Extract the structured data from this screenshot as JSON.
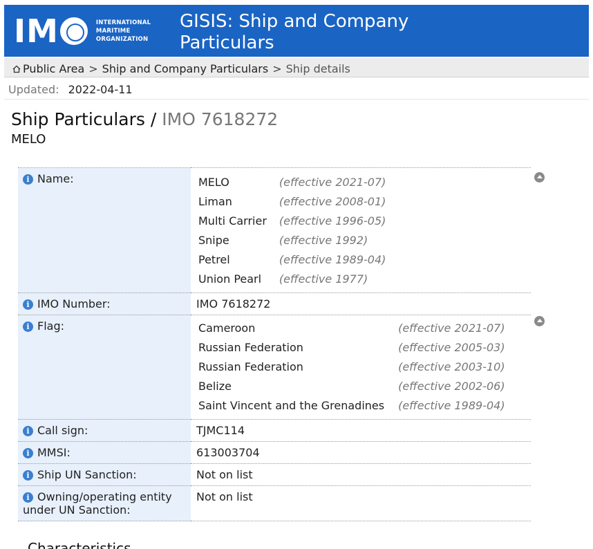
{
  "header": {
    "logo_letters": "IMO",
    "org_lines": [
      "INTERNATIONAL",
      "MARITIME",
      "ORGANIZATION"
    ],
    "title": "GISIS: Ship and Company Particulars",
    "color": "#1a64c4"
  },
  "breadcrumb": {
    "home": "Public Area",
    "items": [
      "Ship and Company Particulars"
    ],
    "current": "Ship details"
  },
  "updated": {
    "label": "Updated:",
    "value": "2022-04-11"
  },
  "page": {
    "title": "Ship Particulars /",
    "imo": "IMO 7618272",
    "ship_name": "MELO"
  },
  "particulars": {
    "name": {
      "label": "Name:",
      "history": [
        {
          "value": "MELO",
          "effective": "(effective 2021-07)"
        },
        {
          "value": "Liman",
          "effective": "(effective 2008-01)"
        },
        {
          "value": "Multi Carrier",
          "effective": "(effective 1996-05)"
        },
        {
          "value": "Snipe",
          "effective": "(effective 1992)"
        },
        {
          "value": "Petrel",
          "effective": "(effective 1989-04)"
        },
        {
          "value": "Union Pearl",
          "effective": "(effective 1977)"
        }
      ]
    },
    "imo_number": {
      "label": "IMO Number:",
      "value": "IMO 7618272"
    },
    "flag": {
      "label": "Flag:",
      "history": [
        {
          "value": "Cameroon",
          "effective": "(effective 2021-07)"
        },
        {
          "value": "Russian Federation",
          "effective": "(effective 2005-03)"
        },
        {
          "value": "Russian Federation",
          "effective": "(effective 2003-10)"
        },
        {
          "value": "Belize",
          "effective": "(effective 2002-06)"
        },
        {
          "value": "Saint Vincent and the Grenadines",
          "effective": "(effective 1989-04)"
        }
      ]
    },
    "call_sign": {
      "label": "Call sign:",
      "value": "TJMC114"
    },
    "mmsi": {
      "label": "MMSI:",
      "value": "613003704"
    },
    "un_sanction": {
      "label": "Ship UN Sanction:",
      "value": "Not on list"
    },
    "entity_sanction": {
      "label": "Owning/operating entity under UN Sanction:",
      "value": "Not on list"
    }
  },
  "sections": {
    "characteristics": "Characteristics"
  }
}
